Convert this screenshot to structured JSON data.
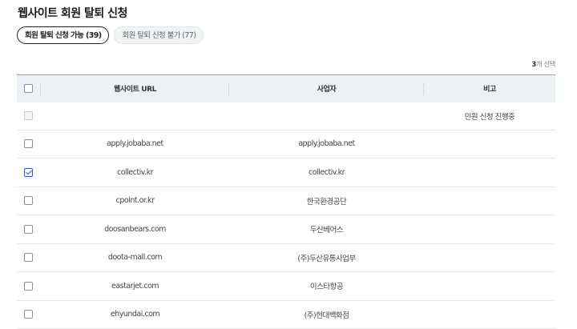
{
  "page": {
    "title": "웹사이트 회원 탈퇴 신청"
  },
  "tabs": [
    {
      "label": "회원 탈퇴 신청 가능 (39)",
      "active": true
    },
    {
      "label": "회원 탈퇴 신청 불가 (77)",
      "active": false
    }
  ],
  "selection": {
    "count": "3",
    "suffix": "개 선택"
  },
  "table": {
    "headers": {
      "url": "웹사이트 URL",
      "operator": "사업자",
      "note": "비고"
    },
    "rows": [
      {
        "url": "",
        "operator": "",
        "note": "민원 신청 진행중",
        "checked": false,
        "disabled": true
      },
      {
        "url": "apply.jobaba.net",
        "operator": "apply.jobaba.net",
        "note": "",
        "checked": false,
        "disabled": false
      },
      {
        "url": "collectiv.kr",
        "operator": "collectiv.kr",
        "note": "",
        "checked": true,
        "disabled": false
      },
      {
        "url": "cpoint.or.kr",
        "operator": "한국환경공단",
        "note": "",
        "checked": false,
        "disabled": false
      },
      {
        "url": "doosanbears.com",
        "operator": "두산베어스",
        "note": "",
        "checked": false,
        "disabled": false
      },
      {
        "url": "doota-mall.com",
        "operator": "(주)두산유통사업부",
        "note": "",
        "checked": false,
        "disabled": false
      },
      {
        "url": "eastarjet.com",
        "operator": "이스타항공",
        "note": "",
        "checked": false,
        "disabled": false
      },
      {
        "url": "ehyundai.com",
        "operator": "(주)현대백화점",
        "note": "",
        "checked": false,
        "disabled": false
      }
    ]
  },
  "colors": {
    "accent": "#1f5fd6",
    "header_bg": "#eef0f3"
  }
}
